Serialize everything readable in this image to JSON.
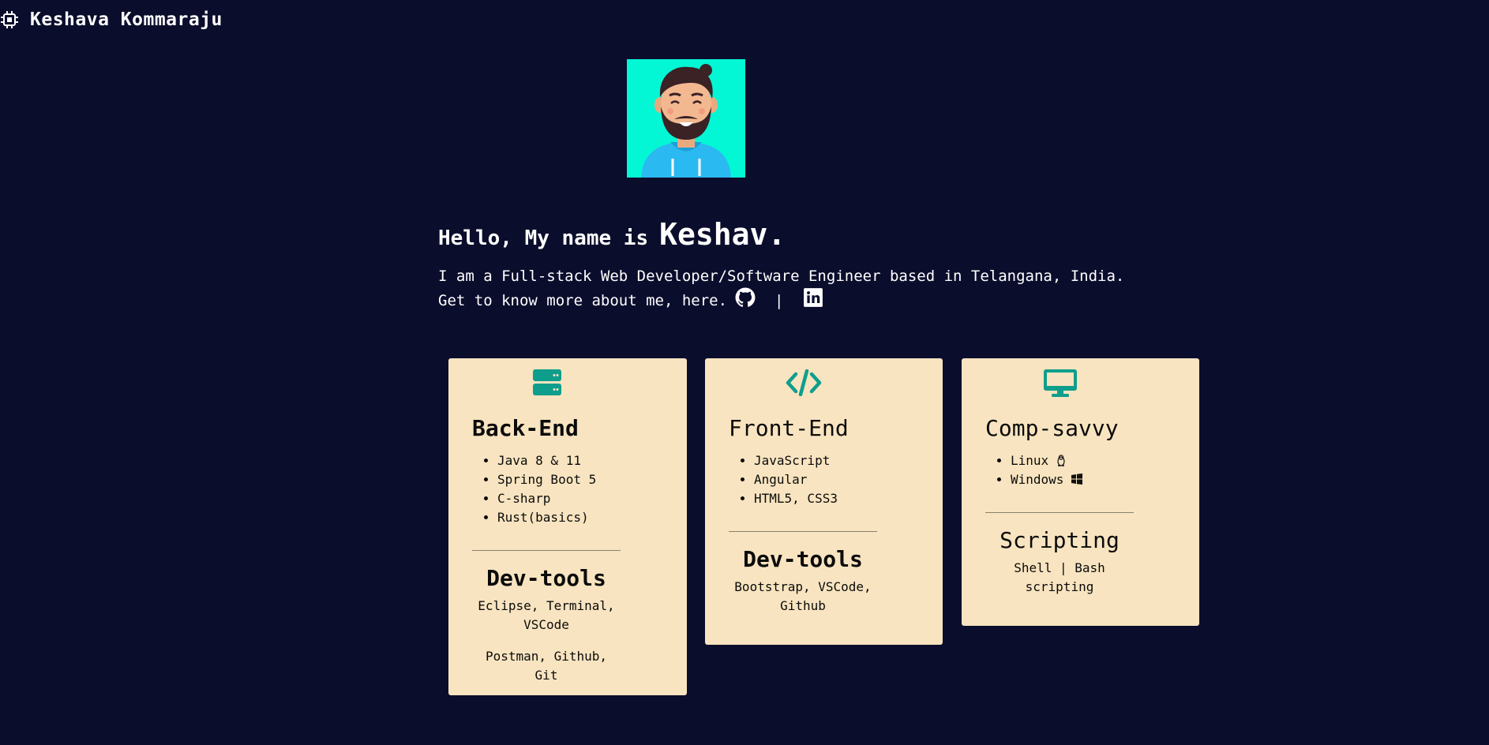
{
  "header": {
    "brand_icon": "cpu-chip-icon",
    "brand_name": "Keshava Kommaraju"
  },
  "avatar": {
    "icon": "developer-avatar",
    "background": "#03f7d5"
  },
  "intro": {
    "greeting_prefix": "Hello, My name is",
    "name": "Keshav.",
    "bio_line1": "I am a Full-stack Web Developer/Software Engineer based in Telangana, India.",
    "bio_line2": "Get to know more about me, here.",
    "separator": "|",
    "links": [
      "github-icon",
      "linkedin-icon"
    ]
  },
  "colors": {
    "background": "#0b0d2c",
    "card_bg": "#f8e4c0",
    "accent": "#0f9e8c"
  },
  "cards": [
    {
      "icon": "server-icon",
      "title": "Back-End",
      "items": [
        "Java 8 & 11",
        "Spring Boot 5",
        "C-sharp",
        "Rust(basics)"
      ],
      "sub_title": "Dev-tools",
      "sub_text1": "Eclipse, Terminal, VSCode",
      "sub_text2": "Postman, Github, Git"
    },
    {
      "icon": "code-icon",
      "title": "Front-End",
      "items": [
        "JavaScript",
        "Angular",
        "HTML5, CSS3"
      ],
      "sub_title": "Dev-tools",
      "sub_text1": "Bootstrap, VSCode, Github"
    },
    {
      "icon": "desktop-icon",
      "title": "Comp-savvy",
      "items": [
        "Linux",
        "Windows"
      ],
      "item_icons": [
        "linux-penguin-icon",
        "windows-icon"
      ],
      "sub_title": "Scripting",
      "sub_text1": "Shell | Bash scripting"
    }
  ]
}
